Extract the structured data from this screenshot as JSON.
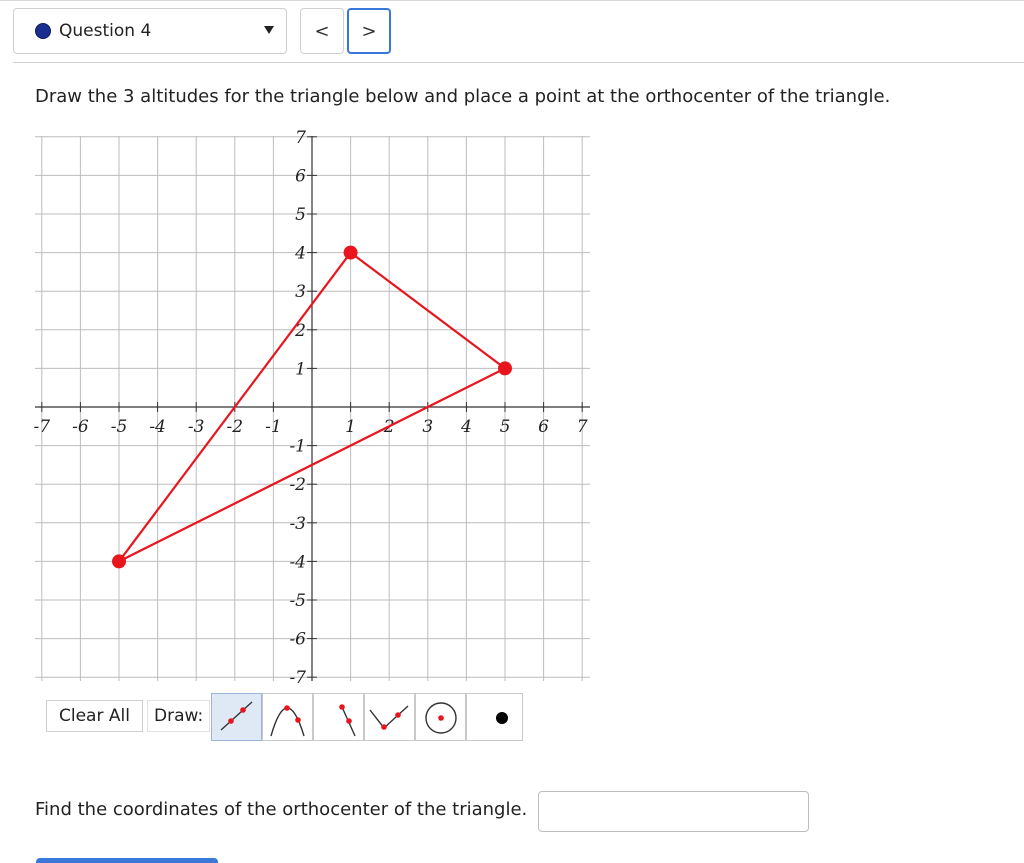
{
  "header": {
    "question_label": "Question 4",
    "prev_symbol": "<",
    "next_symbol": ">",
    "status_color": "#1a2f8f"
  },
  "prompt": "Draw the 3 altitudes for the triangle below and place a point at the orthocenter of the triangle.",
  "graph": {
    "x_ticks": [
      "-7",
      "-6",
      "-5",
      "-4",
      "-3",
      "-2",
      "-1",
      "1",
      "2",
      "3",
      "4",
      "5",
      "6",
      "7"
    ],
    "y_ticks": [
      "7",
      "6",
      "5",
      "4",
      "3",
      "2",
      "1",
      "-1",
      "-2",
      "-3",
      "-4",
      "-5",
      "-6",
      "-7"
    ],
    "x_range": [
      -7,
      7
    ],
    "y_range": [
      -7,
      7
    ],
    "grid": true,
    "triangle_color": "#e8161c",
    "triangle_vertices": [
      [
        1,
        4
      ],
      [
        5,
        1
      ],
      [
        -5,
        -4
      ]
    ]
  },
  "toolbar": {
    "clear_all_label": "Clear All",
    "draw_label": "Draw:",
    "tools": [
      "line-segment-icon",
      "parabola-icon",
      "ray-icon",
      "vector-icon",
      "circle-icon",
      "point-icon"
    ],
    "selected_tool": "line-segment-icon"
  },
  "find_prompt": "Find the coordinates of the orthocenter of the triangle.",
  "answer": {
    "value": ""
  }
}
